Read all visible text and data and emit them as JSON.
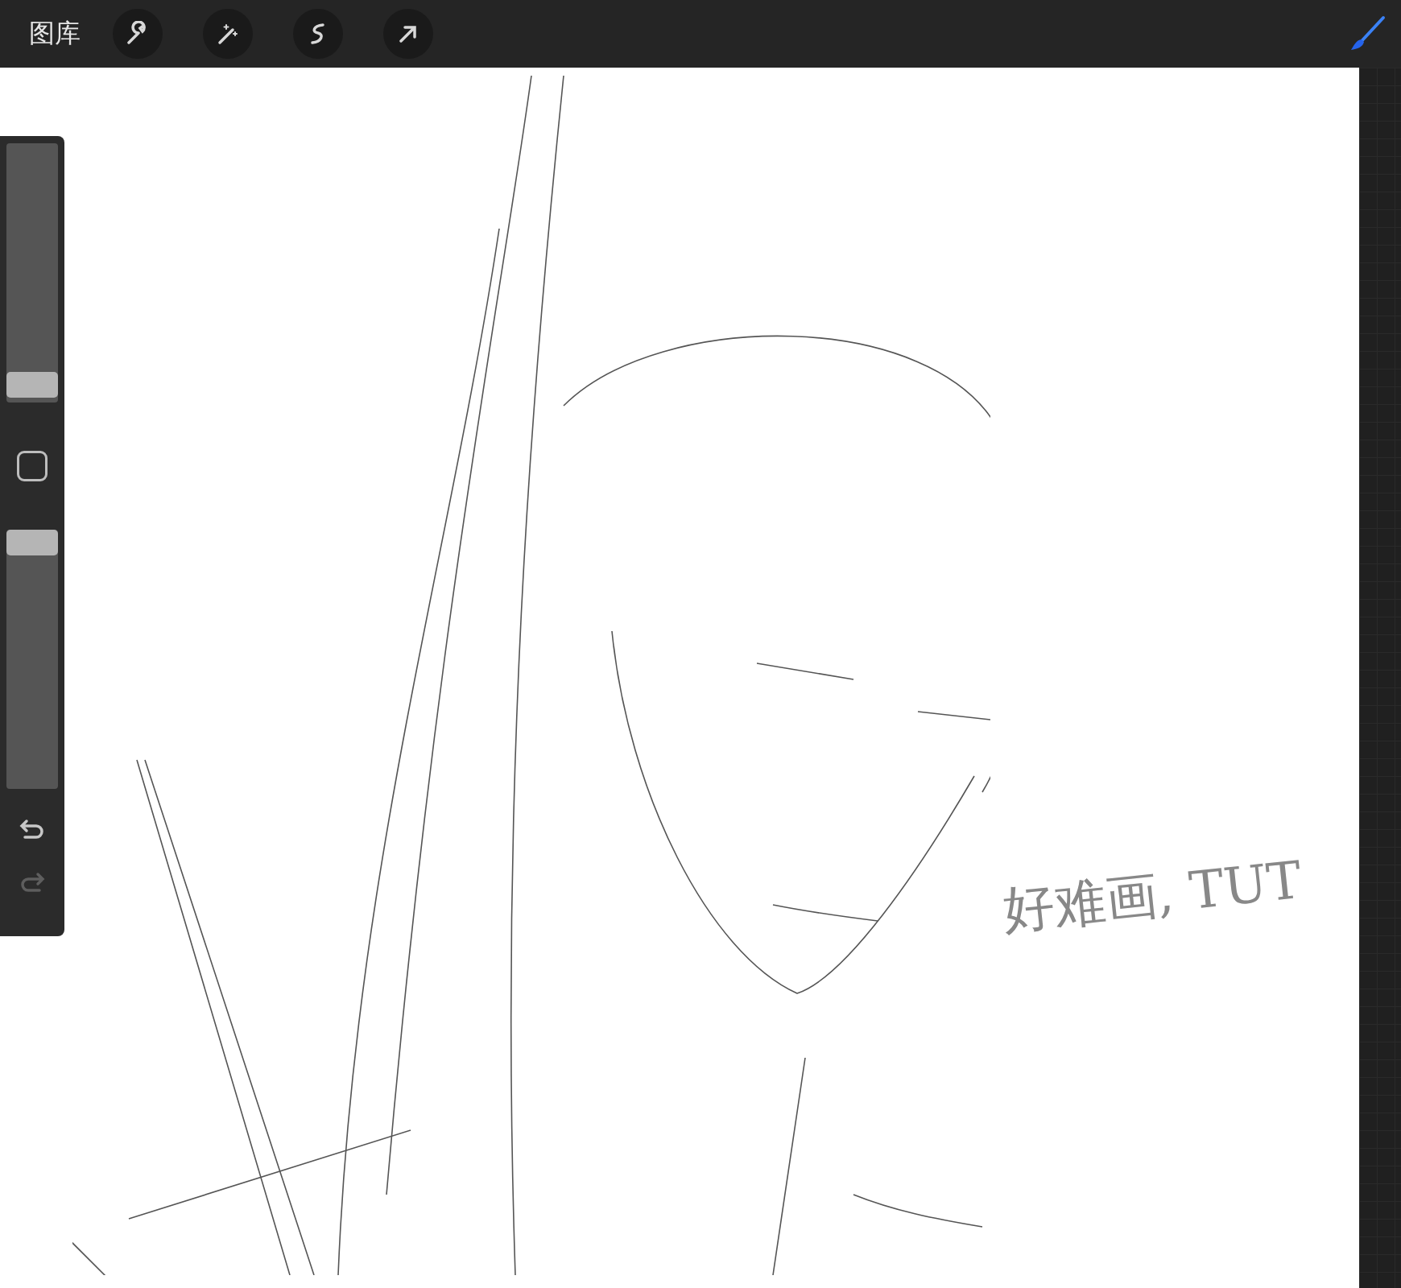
{
  "toolbar": {
    "gallery_label": "图库",
    "tools": [
      {
        "kind": "wrench"
      },
      {
        "kind": "wand"
      },
      {
        "kind": "selection"
      },
      {
        "kind": "arrow"
      }
    ],
    "brush": {
      "selected": true
    }
  },
  "sidebar": {
    "size_slider": {
      "level": 0.02
    },
    "opacity_slider": {
      "level": 1
    },
    "undo": {
      "disabled": false
    },
    "redo": {
      "disabled": true
    }
  },
  "canvas": {
    "note": "好难画, TUT"
  }
}
